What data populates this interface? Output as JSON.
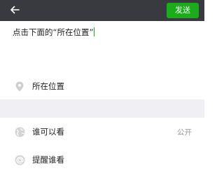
{
  "header": {
    "back_icon": "back-arrow-icon",
    "send_label": "发送",
    "accent_color": "#1aad19",
    "bar_color": "#393a3f"
  },
  "compose": {
    "text": "点击下面的“所在位置”"
  },
  "options": {
    "location": {
      "icon": "location-pin-icon",
      "label": "所在位置"
    },
    "visibility": {
      "icon": "globe-icon",
      "label": "谁可以看",
      "value": "公开"
    },
    "mention": {
      "icon": "at-sign-icon",
      "label": "提醒谁看"
    }
  }
}
